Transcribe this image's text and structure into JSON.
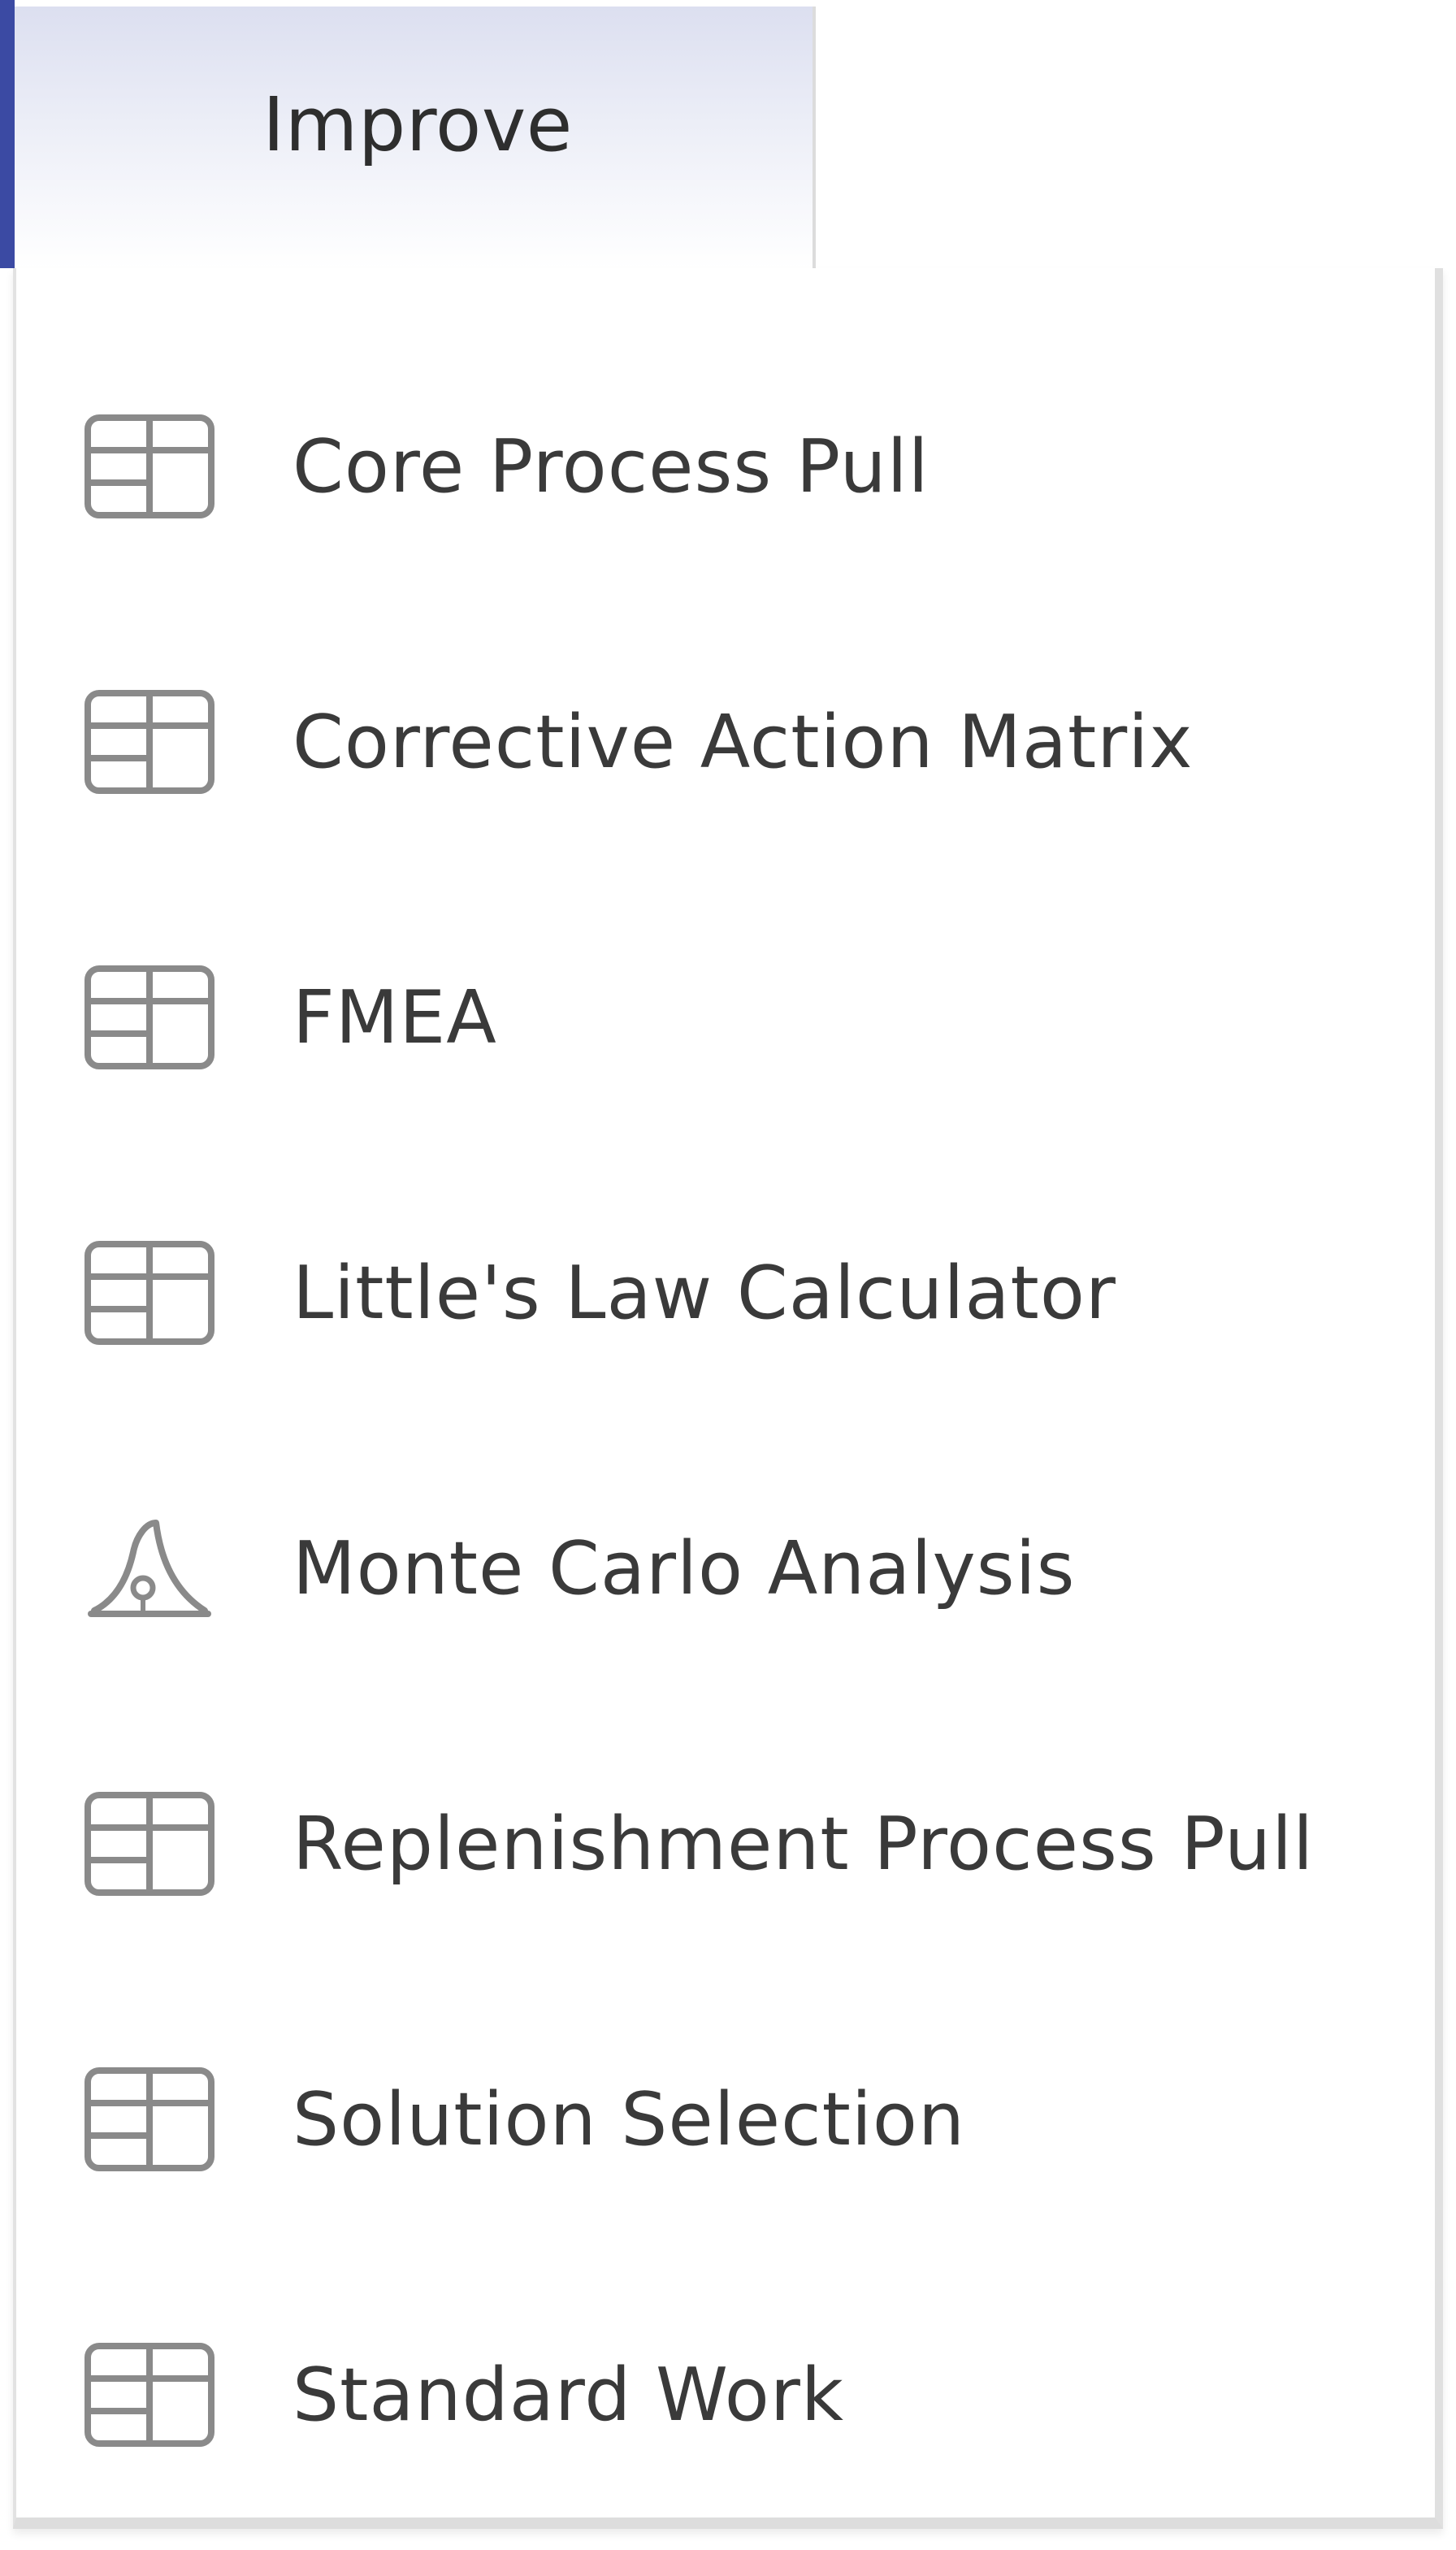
{
  "tab": {
    "label": "Improve"
  },
  "menu": {
    "items": [
      {
        "label": "Core Process Pull",
        "icon": "table-grid-icon"
      },
      {
        "label": "Corrective Action Matrix",
        "icon": "table-grid-icon"
      },
      {
        "label": "FMEA",
        "icon": "table-grid-icon"
      },
      {
        "label": "Little's Law Calculator",
        "icon": "table-grid-icon"
      },
      {
        "label": "Monte Carlo Analysis",
        "icon": "distribution-curve-icon"
      },
      {
        "label": "Replenishment Process Pull",
        "icon": "table-grid-icon"
      },
      {
        "label": "Solution Selection",
        "icon": "table-grid-icon"
      },
      {
        "label": "Standard Work",
        "icon": "table-grid-icon"
      }
    ]
  },
  "colors": {
    "accent": "#3b4aa3",
    "text": "#3a3a3a",
    "icon": "#8a8a8a"
  }
}
